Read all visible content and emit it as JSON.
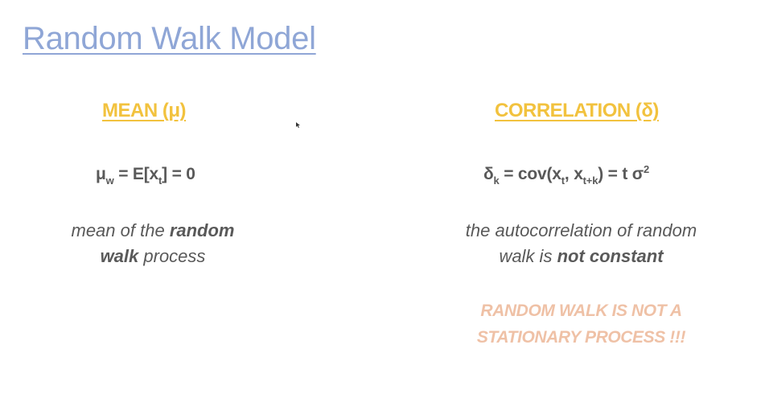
{
  "slide": {
    "title": "Random Walk Model",
    "mean": {
      "heading": "MEAN (μ)",
      "formula": {
        "mu": "μ",
        "mu_sub": "w",
        "mid": " = E[x",
        "x_sub": "t",
        "end": "] = 0"
      },
      "desc": {
        "part1": "mean of the ",
        "bold1": "random",
        "bold2": "walk",
        "part2": " process"
      }
    },
    "correlation": {
      "heading": "CORRELATION (δ)",
      "formula": {
        "delta": "δ",
        "delta_sub": "k",
        "mid": " = cov(x",
        "x1_sub": "t",
        "comma": ", x",
        "x2_sub": "t+k",
        "end": ") = t σ",
        "sup": "2"
      },
      "desc": {
        "line1": "the autocorrelation of random",
        "part2": "walk is ",
        "bold": "not constant"
      },
      "warning": {
        "line1": "RANDOM WALK IS NOT A",
        "line2": "STATIONARY PROCESS !!!"
      }
    }
  },
  "colors": {
    "title": "#8fa6d6",
    "heading": "#f2c23e",
    "body_text": "#595959",
    "warning": "#efc1a6"
  }
}
